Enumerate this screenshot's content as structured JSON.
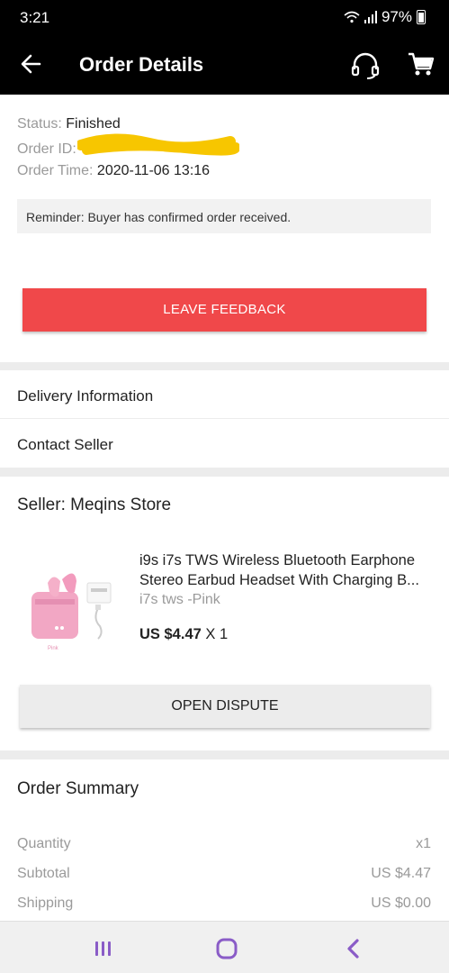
{
  "status_bar": {
    "time": "3:21",
    "battery": "97%"
  },
  "header": {
    "title": "Order Details",
    "back_icon": "arrow-left-icon",
    "support_icon": "headset-icon",
    "cart_icon": "cart-icon"
  },
  "order": {
    "status_label": "Status:",
    "status_value": "Finished",
    "id_label": "Order ID:",
    "time_label": "Order Time:",
    "time_value": "2020-11-06 13:16",
    "reminder": "Reminder: Buyer has confirmed order received.",
    "feedback_label": "LEAVE FEEDBACK"
  },
  "links": {
    "delivery": "Delivery Information",
    "contact": "Contact Seller"
  },
  "seller": {
    "title": "Seller: Meqins Store",
    "product": {
      "name_line1": "i9s i7s TWS Wireless Bluetooth Earphone",
      "name_line2": "Stereo Earbud Headset With Charging B...",
      "variant": "i7s tws -Pink",
      "price": "US $4.47",
      "qty": "X 1",
      "image_label": "Pink"
    },
    "dispute_label": "OPEN DISPUTE"
  },
  "summary": {
    "title": "Order Summary",
    "rows": [
      {
        "label": "Quantity",
        "value": "x1"
      },
      {
        "label": "Subtotal",
        "value": "US $4.47"
      },
      {
        "label": "Shipping",
        "value": "US $0.00"
      }
    ]
  },
  "colors": {
    "accent": "#f0484a",
    "header_bg": "#000000",
    "muted_text": "#9a9a9a"
  }
}
